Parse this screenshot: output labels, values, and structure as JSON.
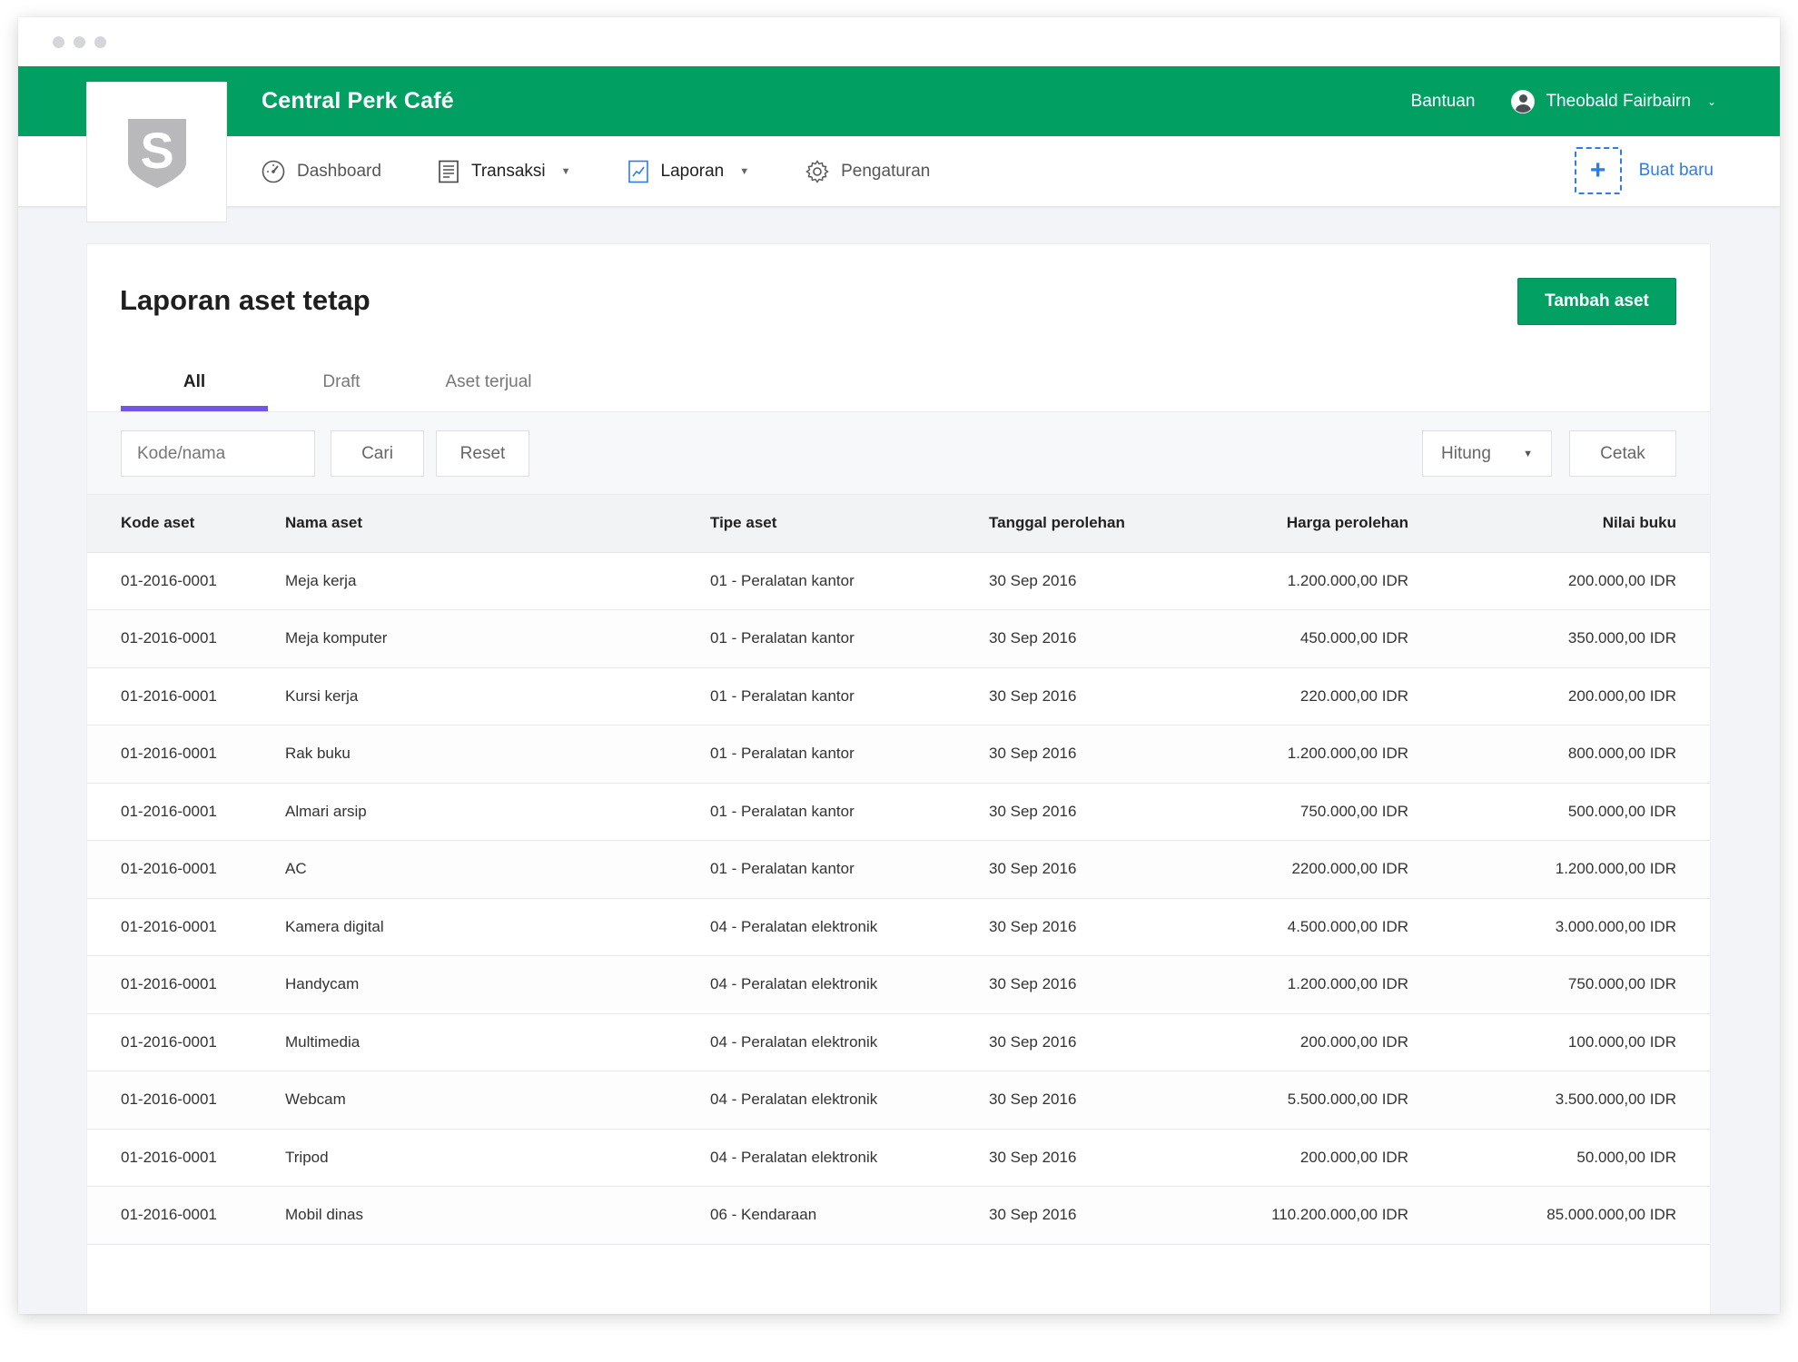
{
  "app": {
    "name": "Central Perk Café",
    "help": "Bantuan",
    "user": "Theobald Fairbairn"
  },
  "nav": {
    "items": [
      {
        "label": "Dashboard",
        "icon": "dashboard-gauge-icon"
      },
      {
        "label": "Transaksi",
        "icon": "receipt-icon"
      },
      {
        "label": "Laporan",
        "icon": "report-chart-icon"
      },
      {
        "label": "Pengaturan",
        "icon": "gear-icon"
      }
    ],
    "create_new": "Buat baru"
  },
  "page": {
    "title": "Laporan aset tetap",
    "add_button": "Tambah aset",
    "tabs": [
      "All",
      "Draft",
      "Aset terjual"
    ],
    "active_tab": "All"
  },
  "filters": {
    "search_placeholder": "Kode/nama",
    "search_button": "Cari",
    "reset_button": "Reset",
    "calc_select": "Hitung",
    "print_button": "Cetak"
  },
  "table": {
    "columns": [
      "Kode aset",
      "Nama aset",
      "Tipe aset",
      "Tanggal perolehan",
      "Harga perolehan",
      "Nilai buku"
    ],
    "rows": [
      [
        "01-2016-0001",
        "Meja kerja",
        "01 - Peralatan kantor",
        "30 Sep 2016",
        "1.200.000,00 IDR",
        "200.000,00 IDR"
      ],
      [
        "01-2016-0001",
        "Meja komputer",
        "01 - Peralatan kantor",
        "30 Sep 2016",
        "450.000,00 IDR",
        "350.000,00 IDR"
      ],
      [
        "01-2016-0001",
        "Kursi kerja",
        "01 - Peralatan kantor",
        "30 Sep 2016",
        "220.000,00 IDR",
        "200.000,00 IDR"
      ],
      [
        "01-2016-0001",
        "Rak buku",
        "01 - Peralatan kantor",
        "30 Sep 2016",
        "1.200.000,00 IDR",
        "800.000,00 IDR"
      ],
      [
        "01-2016-0001",
        "Almari arsip",
        "01 - Peralatan kantor",
        "30 Sep 2016",
        "750.000,00 IDR",
        "500.000,00 IDR"
      ],
      [
        "01-2016-0001",
        "AC",
        "01 - Peralatan kantor",
        "30 Sep 2016",
        "2200.000,00 IDR",
        "1.200.000,00 IDR"
      ],
      [
        "01-2016-0001",
        "Kamera digital",
        "04 - Peralatan elektronik",
        "30 Sep 2016",
        "4.500.000,00 IDR",
        "3.000.000,00 IDR"
      ],
      [
        "01-2016-0001",
        "Handycam",
        "04 - Peralatan elektronik",
        "30 Sep 2016",
        "1.200.000,00 IDR",
        "750.000,00 IDR"
      ],
      [
        "01-2016-0001",
        "Multimedia",
        "04 - Peralatan elektronik",
        "30 Sep 2016",
        "200.000,00 IDR",
        "100.000,00 IDR"
      ],
      [
        "01-2016-0001",
        "Webcam",
        "04 - Peralatan elektronik",
        "30 Sep 2016",
        "5.500.000,00 IDR",
        "3.500.000,00 IDR"
      ],
      [
        "01-2016-0001",
        "Tripod",
        "04 - Peralatan elektronik",
        "30 Sep 2016",
        "200.000,00 IDR",
        "50.000,00 IDR"
      ],
      [
        "01-2016-0001",
        "Mobil dinas",
        "06 - Kendaraan",
        "30 Sep 2016",
        "110.200.000,00 IDR",
        "85.000.000,00 IDR"
      ]
    ]
  },
  "colors": {
    "brand_green": "#01a062",
    "accent_blue": "#2f7de1",
    "tab_underline": "#7254e8"
  }
}
